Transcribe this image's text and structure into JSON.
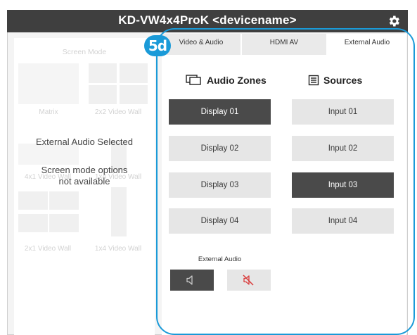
{
  "window": {
    "title": "KD-VW4x4ProK <devicename>",
    "settings_icon": "gear-icon"
  },
  "badge": "5d",
  "left_panel": {
    "heading": "Screen Mode",
    "modes": [
      "Matrix",
      "2x2 Video Wall",
      "4x1 Video Wall",
      "1x4 Video Wall",
      "2x1 Video Wall",
      "1x4 Video Wall"
    ],
    "notice_title": "External Audio Selected",
    "notice_line1": "Screen mode options",
    "notice_line2": "not available"
  },
  "tabs": [
    {
      "label": "Video & Audio",
      "active": false
    },
    {
      "label": "HDMI AV",
      "active": false
    },
    {
      "label": "External Audio",
      "active": true
    }
  ],
  "audio_zones": {
    "heading": "Audio Zones",
    "icon": "displays-icon",
    "items": [
      {
        "label": "Display 01",
        "selected": true
      },
      {
        "label": "Display 02",
        "selected": false
      },
      {
        "label": "Display 03",
        "selected": false
      },
      {
        "label": "Display 04",
        "selected": false
      }
    ]
  },
  "sources": {
    "heading": "Sources",
    "icon": "sources-list-icon",
    "items": [
      {
        "label": "Input 01",
        "selected": false
      },
      {
        "label": "Input 02",
        "selected": false
      },
      {
        "label": "Input 03",
        "selected": true
      },
      {
        "label": "Input 04",
        "selected": false
      }
    ]
  },
  "external_audio": {
    "label": "External Audio",
    "speaker_icon": "speaker-icon",
    "mute_icon": "speaker-muted-icon"
  },
  "colors": {
    "accent": "#1a9ad8",
    "selected": "#4a4a4a",
    "titlebar": "#3f3f3f",
    "mute": "#d93a3a"
  }
}
